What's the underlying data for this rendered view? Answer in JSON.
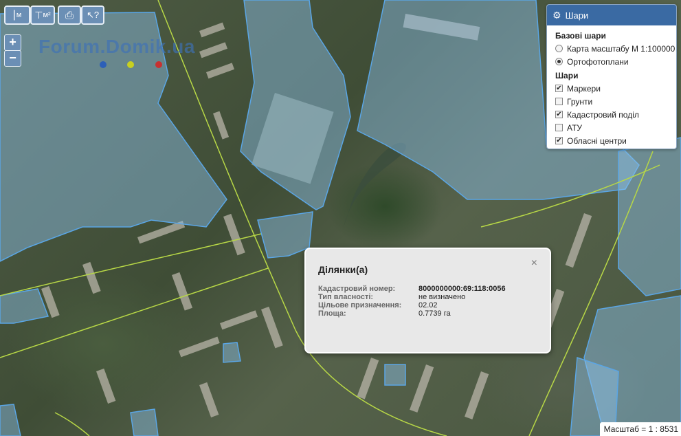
{
  "toolbar": {
    "btn1_label": "м",
    "btn2_label": "м²",
    "print_icon": "printer-icon",
    "info_icon": "pointer-help-icon"
  },
  "zoom": {
    "plus": "+",
    "minus": "−"
  },
  "watermark": "Forum.Domik.ua",
  "watermark_dots": [
    "#2c5fb8",
    "#c8d020",
    "#c83030"
  ],
  "layers_panel": {
    "title": "Шари",
    "icon": "gear-icon",
    "base_heading": "Базові шари",
    "base_options": [
      {
        "label": "Карта масштабу М 1:100000",
        "selected": false
      },
      {
        "label": "Ортофотоплани",
        "selected": true
      }
    ],
    "layers_heading": "Шари",
    "layers": [
      {
        "label": "Маркери",
        "checked": true
      },
      {
        "label": "Грунти",
        "checked": false
      },
      {
        "label": "Кадастровий поділ",
        "checked": true
      },
      {
        "label": "АТУ",
        "checked": false
      },
      {
        "label": "Обласні центри",
        "checked": true
      }
    ]
  },
  "popup": {
    "title": "Ділянки(а)",
    "close": "×",
    "fields": [
      {
        "key": "Кадастровий номер:",
        "value": "8000000000:69:118:0056"
      },
      {
        "key": "Тип власності:",
        "value": "не визначено"
      },
      {
        "key": "Цільове призначення:",
        "value": "02.02"
      },
      {
        "key": "Площа:",
        "value": "0.7739 га"
      }
    ]
  },
  "scale": "Масштаб = 1 : 8531",
  "colors": {
    "parcel_fill": "#8ec3ee",
    "parcel_stroke": "#5aa6e6",
    "road_line": "#b8d846",
    "panel_header": "#3a6aa3"
  }
}
